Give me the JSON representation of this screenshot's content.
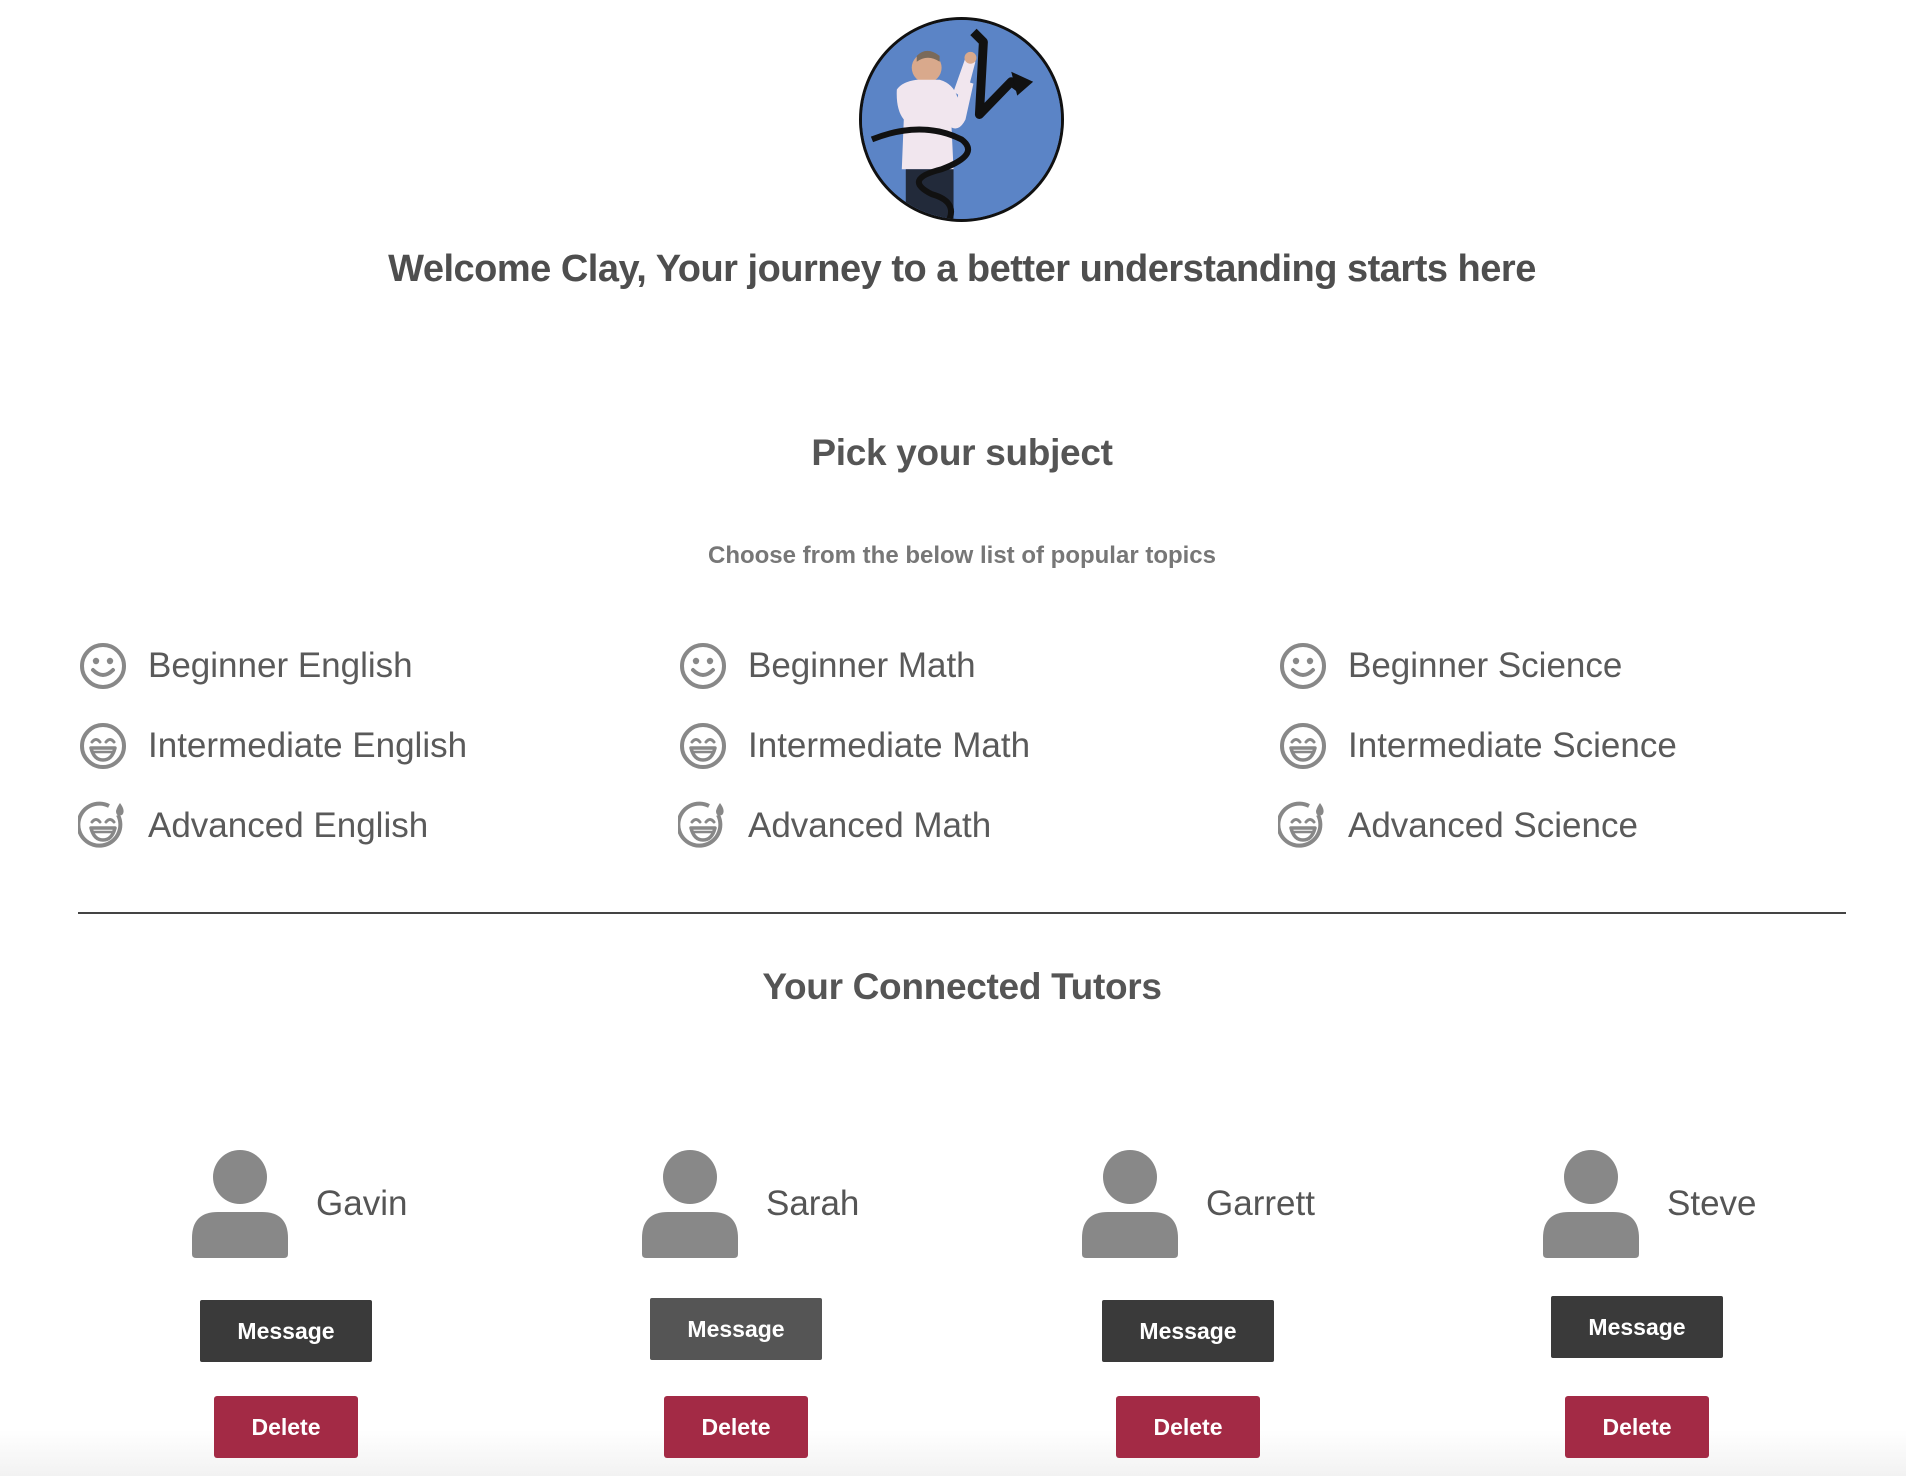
{
  "header": {
    "avatar_alt": "Profile photo",
    "welcome": "Welcome Clay, Your journey to a better understanding starts here"
  },
  "subjects": {
    "title": "Pick your subject",
    "subtitle": "Choose from the below list of popular topics",
    "items": [
      {
        "label": "Beginner English",
        "icon": "smile-icon"
      },
      {
        "label": "Intermediate English",
        "icon": "grin-icon"
      },
      {
        "label": "Advanced English",
        "icon": "grin-sweat-icon"
      },
      {
        "label": "Beginner Math",
        "icon": "smile-icon"
      },
      {
        "label": "Intermediate Math",
        "icon": "grin-icon"
      },
      {
        "label": "Advanced Math",
        "icon": "grin-sweat-icon"
      },
      {
        "label": "Beginner Science",
        "icon": "smile-icon"
      },
      {
        "label": "Intermediate Science",
        "icon": "grin-icon"
      },
      {
        "label": "Advanced Science",
        "icon": "grin-sweat-icon"
      }
    ]
  },
  "tutors": {
    "title": "Your Connected Tutors",
    "message_label": "Message",
    "delete_label": "Delete",
    "items": [
      {
        "name": "Gavin",
        "icon": "user-icon"
      },
      {
        "name": "Sarah",
        "icon": "user-icon"
      },
      {
        "name": "Garrett",
        "icon": "user-icon"
      },
      {
        "name": "Steve",
        "icon": "user-icon"
      }
    ]
  },
  "colors": {
    "message_button": "#3a3a3a",
    "delete_button": "#a32a45",
    "avatar_background": "#5b84c6",
    "icon_gray": "#888888"
  }
}
